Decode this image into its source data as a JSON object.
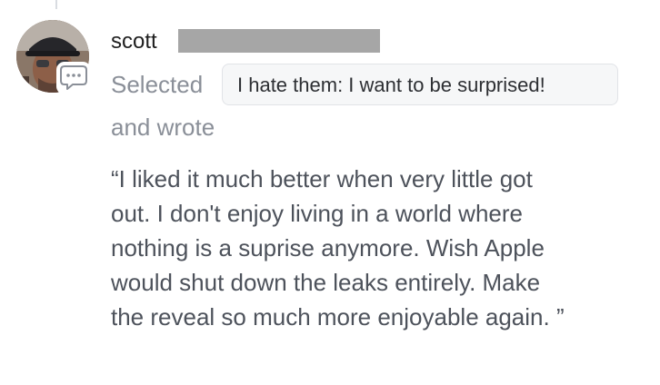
{
  "comment": {
    "author_visible": "scott",
    "action_prefix": "Selected",
    "selected_option": "I hate them: I want to be surprised!",
    "action_suffix": "and wrote",
    "quote_lines": [
      "“I liked it much better when very little got",
      "out. I don't enjoy living in a world where",
      "nothing is a suprise anymore. Wish Apple",
      "would shut down the leaks entirely. Make",
      "the reveal so much more enjoyable again. ”"
    ]
  },
  "icons": {
    "avatar": "user-avatar-photo",
    "badge": "comment-bubble-icon"
  },
  "colors": {
    "muted_text": "#8a8f98",
    "body_text": "#4d525b",
    "pill_background": "#f6f7f8",
    "redaction": "#a6a6a6"
  }
}
